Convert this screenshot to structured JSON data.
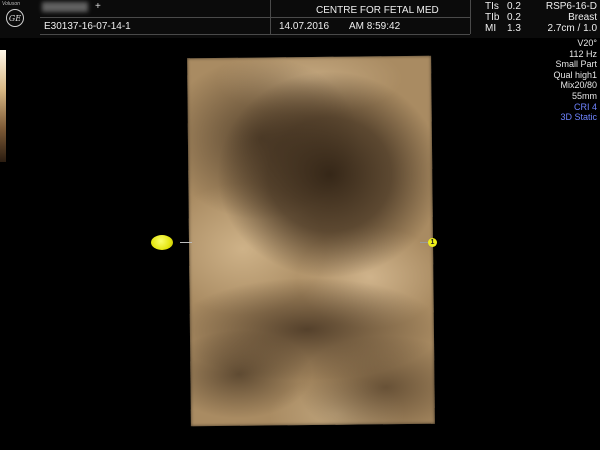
{
  "header": {
    "brand": "Voluson",
    "logo": "GE",
    "patient_name": "",
    "patient_plus": "+",
    "patient_id": "E30137-16-07-14-1",
    "institution": "CENTRE FOR FETAL MED",
    "date": "14.07.2016",
    "time": "AM 8:59:42",
    "tis_label": "TIs",
    "tis_value": "0.2",
    "tib_label": "TIb",
    "tib_value": "0.2",
    "mi_label": "MI",
    "mi_value": "1.3",
    "probe": "RSP6-16-D",
    "preset": "Breast",
    "depth_zoom": "2.7cm / 1.0"
  },
  "side_panel": {
    "lines": [
      "V20°",
      "112 Hz",
      "Small Part",
      "Qual high1",
      "Mix20/80",
      "55mm"
    ],
    "blue_lines": [
      "CRI 4",
      "3D Static"
    ]
  },
  "markers": {
    "right_label": "1"
  },
  "colors": {
    "background": "#000000",
    "tissue_base": "#a98b62",
    "marker_yellow": "#efef1a",
    "accent_blue": "#6f84ff"
  },
  "icons": {
    "logo": "ge-logo-icon",
    "left_marker": "position-marker-icon",
    "right_marker": "numbered-marker-icon"
  }
}
